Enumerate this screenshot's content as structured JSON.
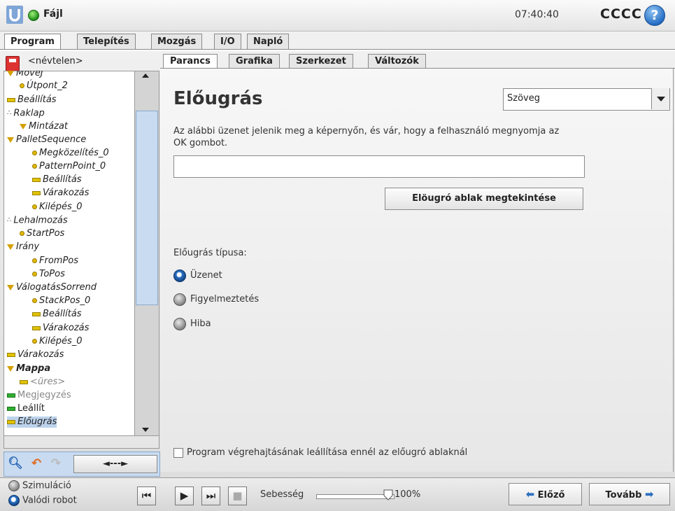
{
  "header": {
    "file_label": "Fájl",
    "clock": "07:40:40",
    "robot_name": "CCCC",
    "help_symbol": "?",
    "status_color": "#2aa12a"
  },
  "main_tabs": [
    {
      "label": "Program",
      "active": true
    },
    {
      "label": "Telepítés",
      "active": false
    },
    {
      "label": "Mozgás",
      "active": false
    },
    {
      "label": "I/O",
      "active": false
    },
    {
      "label": "Napló",
      "active": false
    }
  ],
  "program": {
    "file_name": "<névtelen>"
  },
  "tree": {
    "items": [
      {
        "label": "MoveJ",
        "icon": "triangle-icon"
      },
      {
        "label": "Útpont_2",
        "icon": "waypoint-icon"
      },
      {
        "label": "Beállítás",
        "icon": "bar-icon"
      },
      {
        "label": "Raklap",
        "icon": "dots-icon"
      },
      {
        "label": "Mintázat",
        "icon": "triangle-icon"
      },
      {
        "label": "PalletSequence",
        "icon": "triangle-icon"
      },
      {
        "label": "Megközelítés_0",
        "icon": "waypoint-icon"
      },
      {
        "label": "PatternPoint_0",
        "icon": "waypoint-icon"
      },
      {
        "label": "Beállítás",
        "icon": "bar-icon"
      },
      {
        "label": "Várakozás",
        "icon": "bar-icon"
      },
      {
        "label": "Kilépés_0",
        "icon": "waypoint-icon"
      },
      {
        "label": "Lehalmozás",
        "icon": "dots-icon"
      },
      {
        "label": "StartPos",
        "icon": "waypoint-icon"
      },
      {
        "label": "Irány",
        "icon": "triangle-icon"
      },
      {
        "label": "FromPos",
        "icon": "waypoint-icon"
      },
      {
        "label": "ToPos",
        "icon": "waypoint-icon"
      },
      {
        "label": "VálogatásSorrend",
        "icon": "triangle-icon"
      },
      {
        "label": "StackPos_0",
        "icon": "waypoint-icon"
      },
      {
        "label": "Beállítás",
        "icon": "bar-icon"
      },
      {
        "label": "Várakozás",
        "icon": "bar-icon"
      },
      {
        "label": "Kilépés_0",
        "icon": "waypoint-icon"
      },
      {
        "label": "Várakozás",
        "icon": "bar-icon"
      },
      {
        "label": "Mappa",
        "icon": "triangle-icon"
      },
      {
        "label": "<üres>",
        "icon": "bar-icon"
      },
      {
        "label": "Megjegyzés",
        "icon": "bar-icon"
      },
      {
        "label": "Leállít",
        "icon": "bar-icon"
      },
      {
        "label": "Előugrás",
        "icon": "bar-icon",
        "selected": true
      }
    ]
  },
  "tree_tools": {
    "search_icon": "search-icon",
    "undo_icon": "undo-icon",
    "redo_icon": "redo-icon",
    "move_label": "◄---►"
  },
  "sub_tabs": [
    {
      "label": "Parancs",
      "active": true
    },
    {
      "label": "Grafika",
      "active": false
    },
    {
      "label": "Szerkezet",
      "active": false
    },
    {
      "label": "Változók",
      "active": false
    }
  ],
  "popup": {
    "title": "Előugrás",
    "type_select_value": "Szöveg",
    "description": "Az alábbi üzenet jelenik meg a képernyőn, és vár, hogy a felhasználó megnyomja az OK gombot.",
    "message_value": "",
    "preview_button": "Elöugró ablak megtekintése",
    "type_label": "Előugrás típusa:",
    "types": [
      {
        "label": "Üzenet",
        "selected": true
      },
      {
        "label": "Figyelmeztetés",
        "selected": false
      },
      {
        "label": "Hiba",
        "selected": false
      }
    ],
    "stop_checkbox_label": "Program végrehajtásának leállítása ennél az előugró ablaknál",
    "stop_checked": false
  },
  "footer": {
    "mode_simulation": "Szimuláció",
    "mode_real": "Valódi robot",
    "speed_label": "Sebesség",
    "speed_value": "100%",
    "speed_fraction": 1.0,
    "prev_button": "Előző",
    "next_button": "Tovább"
  }
}
